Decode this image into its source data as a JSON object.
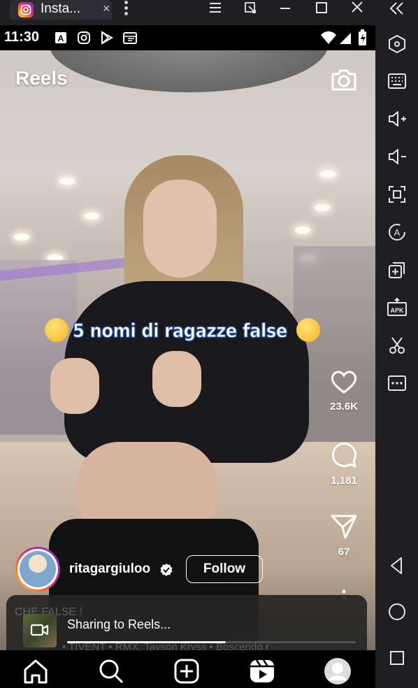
{
  "window": {
    "tab_title": "Insta...",
    "tab_close": "×"
  },
  "status_bar": {
    "time": "11:30"
  },
  "reel": {
    "header_title": "Reels",
    "overlay_caption": "5 nomi di ragazze false",
    "author": {
      "username": "ritagargiuloo",
      "verified": true,
      "follow_label": "Follow"
    },
    "actions": {
      "likes": "23.6K",
      "comments": "1,181",
      "shares": "67"
    },
    "faded_caption": "CHE FALSE !",
    "faded_audio": "• TIVENT • RMX, Tayson Kryss • Boscendo r"
  },
  "toast": {
    "message": "Sharing to Reels...",
    "progress": 0.55
  },
  "bottom_nav": [
    "home",
    "search",
    "create",
    "reels",
    "profile"
  ],
  "colors": {
    "accent_gradient": [
      "#feda75",
      "#fa7e1e",
      "#d62976",
      "#962fbf",
      "#4f5bd5"
    ],
    "toast_bg": "#262626",
    "emulator_chrome": "#1f1f23"
  }
}
